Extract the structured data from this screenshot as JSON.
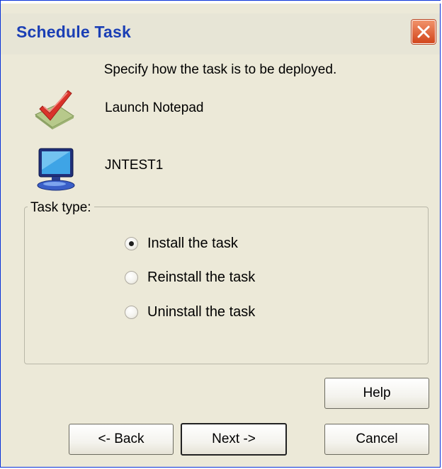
{
  "window": {
    "title": "Schedule Task"
  },
  "instruction": "Specify how the task is to be deployed.",
  "task": {
    "name": "Launch Notepad",
    "icon": "checkmark-task-icon"
  },
  "computer": {
    "name": "JNTEST1",
    "icon": "computer-monitor-icon"
  },
  "task_type": {
    "legend": "Task type:",
    "options": [
      {
        "label": "Install the task",
        "checked": true
      },
      {
        "label": "Reinstall the task",
        "checked": false
      },
      {
        "label": "Uninstall the task",
        "checked": false
      }
    ]
  },
  "buttons": {
    "help": "Help",
    "back": "<- Back",
    "next": "Next ->",
    "cancel": "Cancel"
  },
  "colors": {
    "title_text": "#1b3fb5",
    "close_button": "#d2461c",
    "dialog_bg": "#ece9d8"
  }
}
